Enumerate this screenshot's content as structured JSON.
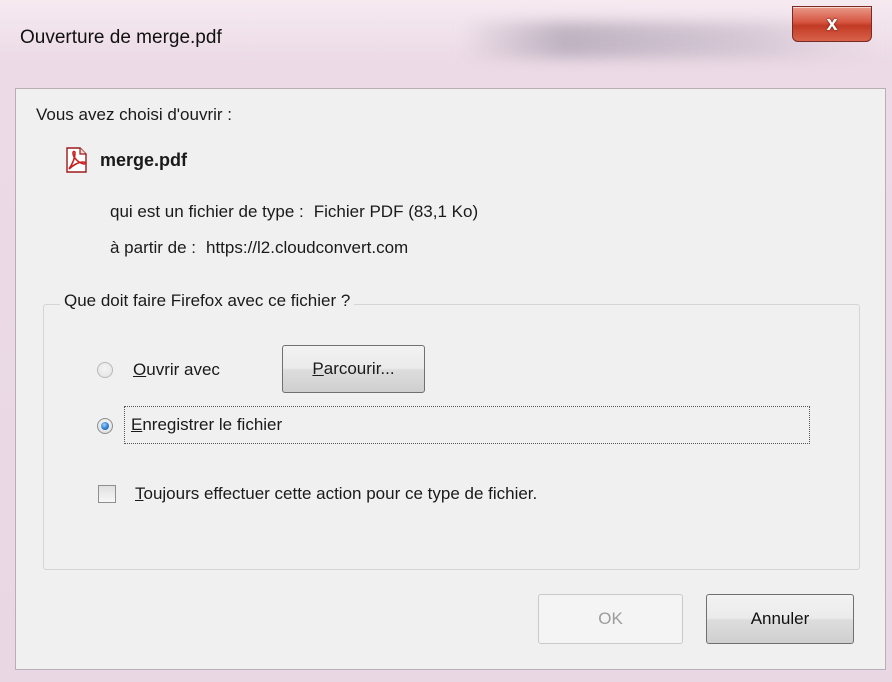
{
  "window": {
    "title": "Ouverture de merge.pdf",
    "close_glyph": "x"
  },
  "dialog": {
    "intro": "Vous avez choisi d'ouvrir :",
    "file": {
      "icon": "pdf-file-icon",
      "name": "merge.pdf"
    },
    "type_label": "qui est un fichier de type :",
    "type_value": "Fichier PDF (83,1 Ko)",
    "source_label": "à partir de :",
    "source_value": "https://l2.cloudconvert.com"
  },
  "options": {
    "legend": "Que doit faire Firefox avec ce fichier ?",
    "open_with": {
      "mnemonic": "O",
      "rest": "uvrir avec",
      "checked": false
    },
    "browse_button": {
      "mnemonic": "P",
      "rest": "arcourir..."
    },
    "save_file": {
      "mnemonic": "E",
      "rest": "nregistrer le fichier",
      "checked": true
    },
    "always": {
      "mnemonic": "T",
      "rest": "oujours effectuer cette action pour ce type de fichier.",
      "checked": false
    }
  },
  "buttons": {
    "ok": "OK",
    "cancel": "Annuler"
  },
  "colors": {
    "close_button": "#d6543f",
    "radio_selected": "#2f7fd4",
    "disabled_text": "#9c9c9c"
  }
}
